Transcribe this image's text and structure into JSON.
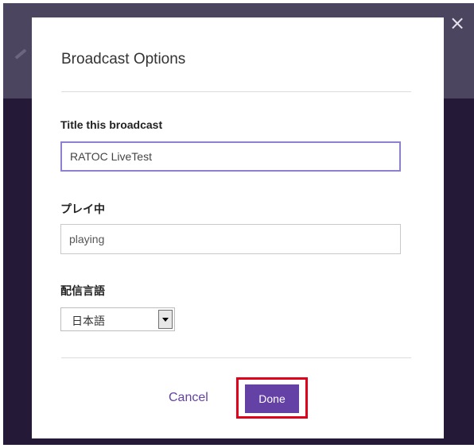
{
  "dialog": {
    "title": "Broadcast Options",
    "title_field": {
      "label": "Title this broadcast",
      "value": "RATOC LiveTest"
    },
    "playing_field": {
      "label": "プレイ中",
      "value": "playing"
    },
    "language_field": {
      "label": "配信言語",
      "selected": "日本語"
    },
    "cancel_label": "Cancel",
    "done_label": "Done",
    "close_symbol": "×"
  },
  "colors": {
    "accent": "#6441a5",
    "focus_border": "#8e7fd0",
    "highlight_box": "#e0001b",
    "backdrop": "#241a37"
  },
  "icons": {
    "close": "close-icon",
    "dropdown": "chevron-down-icon",
    "edit": "pencil-icon"
  }
}
